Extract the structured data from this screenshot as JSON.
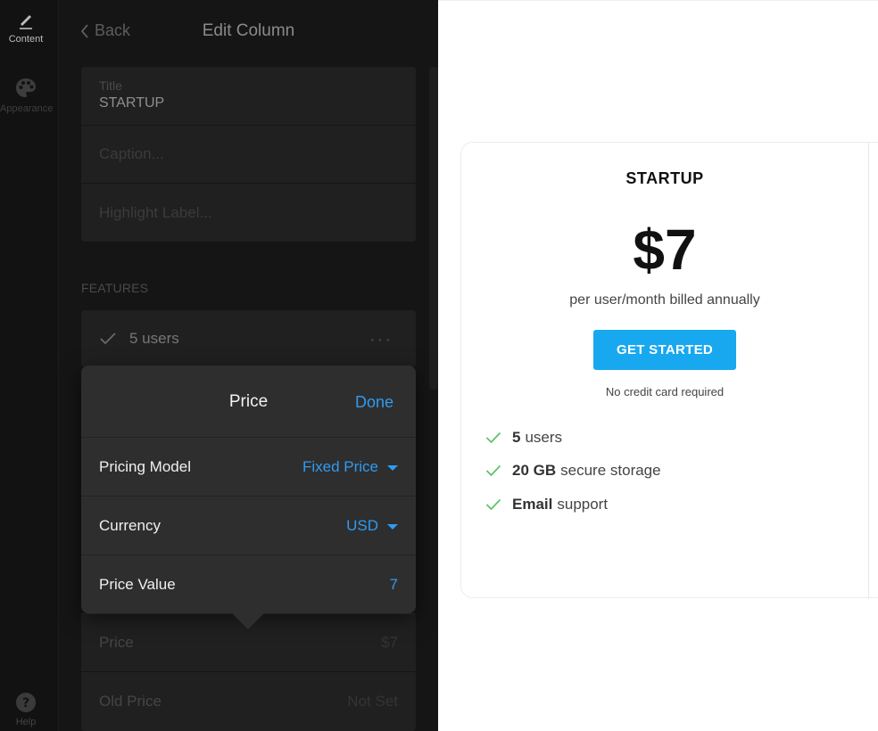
{
  "rail": {
    "items": [
      {
        "label": "Content",
        "icon": "pencil-icon"
      },
      {
        "label": "Appearance",
        "icon": "palette-icon"
      },
      {
        "label": "Help",
        "icon": "help-icon"
      }
    ]
  },
  "editor": {
    "back_label": "Back",
    "title": "Edit Column",
    "title_field": {
      "label": "Title",
      "value": "STARTUP"
    },
    "caption_placeholder": "Caption...",
    "highlight_placeholder": "Highlight Label...",
    "features_heading": "FEATURES",
    "feature_first": "5 users",
    "price_row": {
      "label": "Price",
      "value": "$7"
    },
    "old_price_row": {
      "label": "Old Price",
      "value": "Not Set"
    }
  },
  "popover": {
    "title": "Price",
    "done_label": "Done",
    "rows": [
      {
        "label": "Pricing Model",
        "value": "Fixed Price"
      },
      {
        "label": "Currency",
        "value": "USD"
      },
      {
        "label": "Price Value",
        "value": "7"
      }
    ]
  },
  "preview": {
    "plan_name": "STARTUP",
    "price": "$7",
    "caption": "per user/month billed annually",
    "cta_label": "GET STARTED",
    "cta_note": "No credit card required",
    "features": [
      {
        "bold": "5",
        "text": "users"
      },
      {
        "bold": "20 GB",
        "text": "secure storage"
      },
      {
        "bold": "Email",
        "text": "support"
      }
    ],
    "colors": {
      "accent": "#17a8f0",
      "check": "#5cc46a",
      "link": "#2f9bf2"
    }
  }
}
